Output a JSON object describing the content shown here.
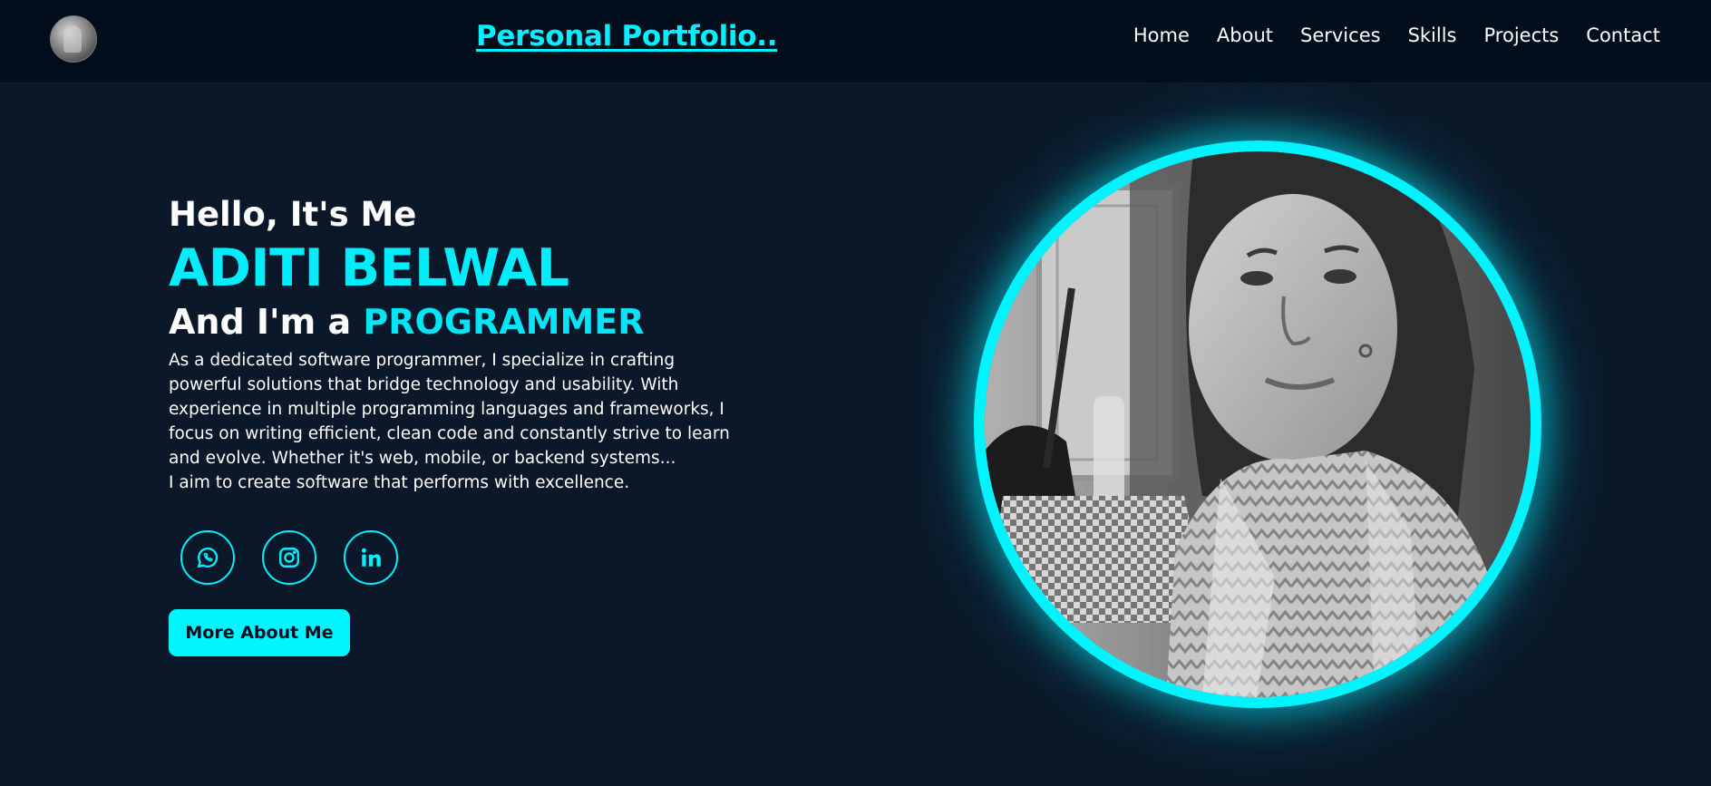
{
  "header": {
    "brand": "Personal Portfolio..",
    "avatar_icon": "profile-avatar",
    "nav": [
      {
        "label": "Home"
      },
      {
        "label": "About"
      },
      {
        "label": "Services"
      },
      {
        "label": "Skills"
      },
      {
        "label": "Projects"
      },
      {
        "label": "Contact"
      }
    ]
  },
  "hero": {
    "greeting": "Hello, It's Me",
    "name": "ADITI BELWAL",
    "role_prefix": "And I'm a ",
    "role": "PROGRAMMER",
    "bio_line1": "As a dedicated software programmer, I specialize in crafting powerful solutions that bridge technology and usability. With experience in multiple programming languages and frameworks, I focus on writing efficient, clean code and constantly strive to learn and evolve. Whether it's web, mobile, or backend systems...",
    "bio_line2": "I aim to create software that performs with excellence.",
    "socials": [
      {
        "icon": "whatsapp-icon"
      },
      {
        "icon": "instagram-icon"
      },
      {
        "icon": "linkedin-icon"
      }
    ],
    "cta_label": "More About Me"
  },
  "colors": {
    "accent": "#00f0ff",
    "background": "#0b1829",
    "navbar": "#020d1b",
    "text": "#ffffff"
  }
}
